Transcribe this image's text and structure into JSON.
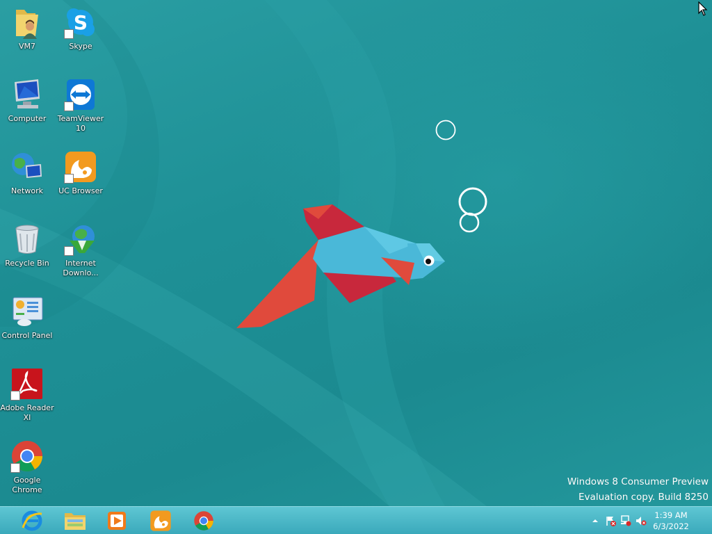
{
  "desktop": {
    "icons": [
      {
        "name": "VM7",
        "icon": "user-folder-icon"
      },
      {
        "name": "Skype",
        "icon": "skype-icon"
      },
      {
        "name": "Computer",
        "icon": "computer-icon"
      },
      {
        "name": "TeamViewer 10",
        "icon": "teamviewer-icon"
      },
      {
        "name": "Network",
        "icon": "network-icon"
      },
      {
        "name": "UC Browser",
        "icon": "uc-browser-icon"
      },
      {
        "name": "Recycle Bin",
        "icon": "recycle-bin-icon"
      },
      {
        "name": "Internet Downlo...",
        "icon": "internet-download-manager-icon"
      },
      {
        "name": "Control Panel",
        "icon": "control-panel-icon"
      },
      {
        "name": "Adobe Reader XI",
        "icon": "adobe-reader-icon"
      },
      {
        "name": "Google Chrome",
        "icon": "chrome-icon"
      }
    ],
    "watermark": {
      "line1": "Windows 8 Consumer Preview",
      "line2": "Evaluation copy. Build 8250"
    }
  },
  "taskbar": {
    "pinned": [
      {
        "app": "Internet Explorer",
        "icon": "internet-explorer-icon"
      },
      {
        "app": "File Explorer",
        "icon": "file-explorer-icon"
      },
      {
        "app": "Windows Media Player",
        "icon": "media-player-icon"
      },
      {
        "app": "UC Browser",
        "icon": "uc-browser-icon"
      },
      {
        "app": "Google Chrome",
        "icon": "chrome-icon"
      }
    ],
    "tray": {
      "icons": [
        "show-hidden-icons-arrow",
        "action-center-flag-icon",
        "network-status-icon",
        "volume-muted-icon"
      ],
      "time": "1:39 AM",
      "date": "6/3/2022"
    }
  },
  "colors": {
    "wallpaper_teal": "#1f8e93",
    "taskbar": "#4bb8c8",
    "fish_body": "#4ab8d8",
    "fish_fin_red": "#c8283c",
    "fish_tail_orange": "#e04a3c"
  }
}
